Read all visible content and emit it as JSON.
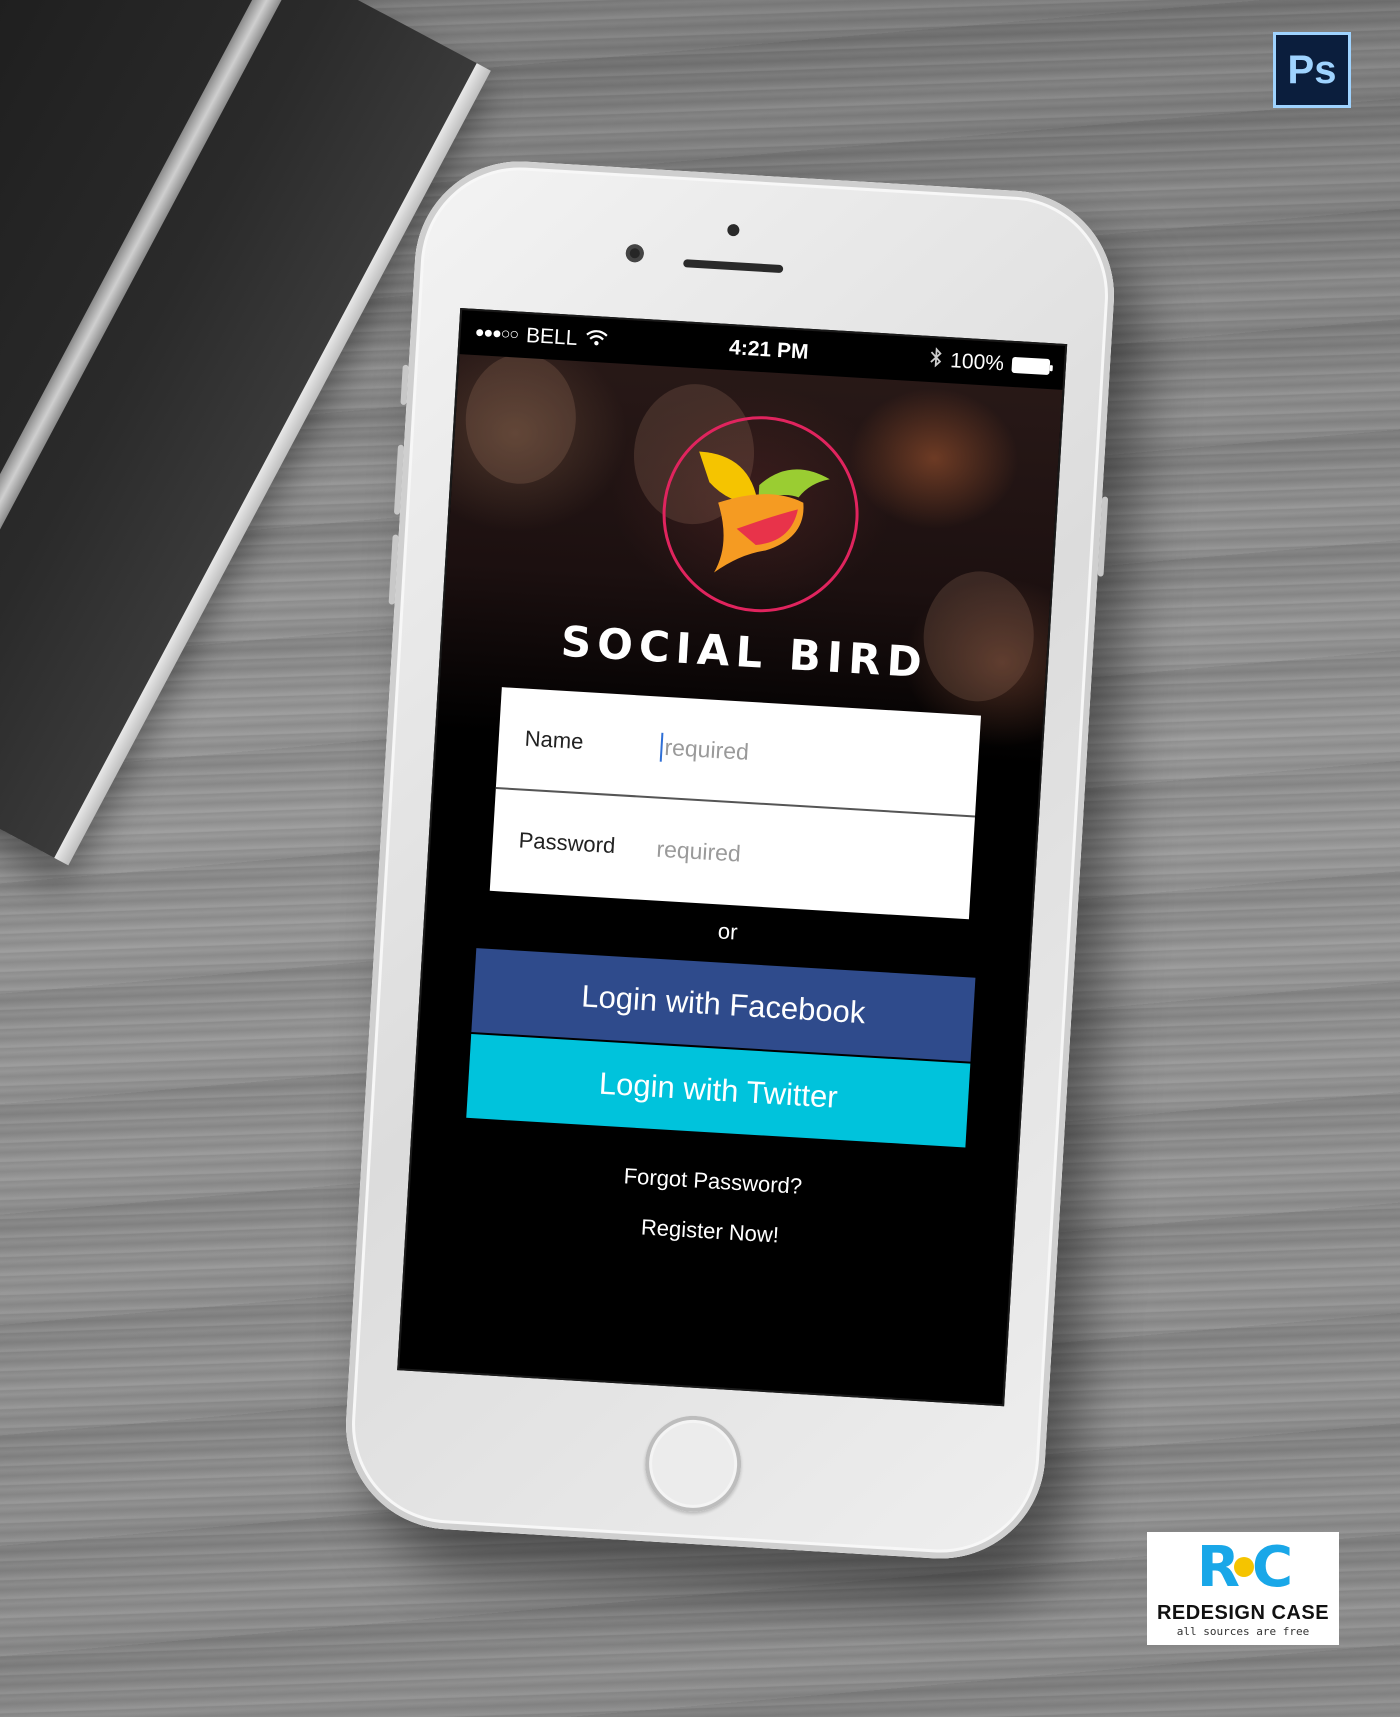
{
  "status_bar": {
    "carrier": "BELL",
    "signal_dots": "●●●○○",
    "time": "4:21 PM",
    "battery": "100%"
  },
  "app": {
    "name": "SOCIAL BIRD"
  },
  "form": {
    "name_label": "Name",
    "name_placeholder": "required",
    "password_label": "Password",
    "password_placeholder": "required"
  },
  "divider_text": "or",
  "buttons": {
    "facebook_label": "Login with Facebook",
    "twitter_label": "Login with Twitter"
  },
  "links": {
    "forgot_password": "Forgot Password?",
    "register": "Register Now!"
  },
  "badges": {
    "photoshop": "Ps",
    "rc_logo_left": "R",
    "rc_logo_right": "C",
    "rc_title": "REDESIGN CASE",
    "rc_subtitle": "all sources are free"
  },
  "colors": {
    "facebook": "#2f4b8c",
    "twitter": "#00c3dc",
    "logo_ring": "#e0245e",
    "rc_blue": "#19a7e8",
    "rc_yellow": "#f5c400"
  },
  "icons": [
    "wifi-icon",
    "bluetooth-icon",
    "battery-icon",
    "bird-logo-icon",
    "photoshop-icon"
  ]
}
